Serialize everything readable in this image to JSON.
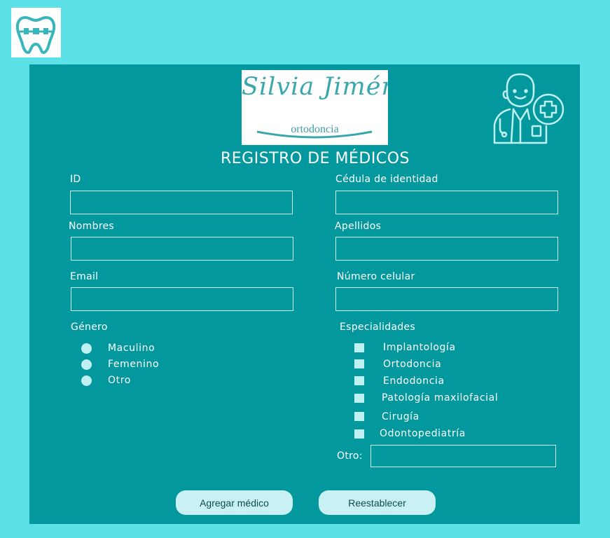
{
  "brand": {
    "script_name": "Silvia Jiménez",
    "subtitle": "ortodoncia",
    "logo_icon": "tooth-braces-icon",
    "doctor_icon": "doctor-plus-icon"
  },
  "form": {
    "title": "REGISTRO DE MÉDICOS",
    "fields": {
      "id": {
        "label": "ID",
        "value": ""
      },
      "cedula": {
        "label": "Cédula de identidad",
        "value": ""
      },
      "nombres": {
        "label": "Nombres",
        "value": ""
      },
      "apellidos": {
        "label": "Apellidos",
        "value": ""
      },
      "email": {
        "label": "Email",
        "value": ""
      },
      "celular": {
        "label": "Número celular",
        "value": ""
      }
    },
    "genero": {
      "label": "Género",
      "options": [
        "Maculino",
        "Femenino",
        "Otro"
      ]
    },
    "especialidades": {
      "label": "Especialidades",
      "options": [
        "Implantología",
        "Ortodoncia",
        "Endodoncia",
        "Patología maxilofacial",
        "Cirugía",
        "Odontopediatría"
      ],
      "otro_label": "Otro:",
      "otro_value": ""
    },
    "buttons": {
      "add": "Agregar médico",
      "reset": "Reestablecer"
    }
  },
  "colors": {
    "page_bg": "#5ce1e6",
    "panel_bg": "#03989e",
    "control_fill": "#bff1f2",
    "button_bg": "#c9f1f3"
  }
}
